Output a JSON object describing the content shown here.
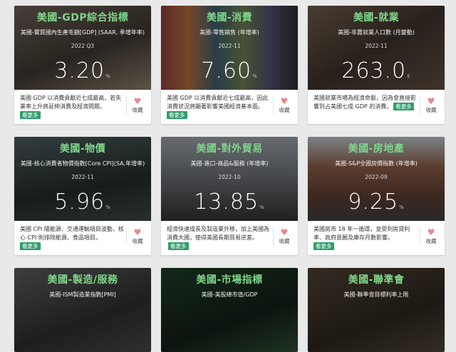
{
  "cards": [
    {
      "title": "美國-GDP綜合指標",
      "subtitle": "美國-實質國內生產毛額[GDP] (SAAR, 季增年率)",
      "date": "2022 Q3",
      "value": "3.20",
      "unit": "%",
      "desc": "美國 GDP 以消費貢獻近七成最高，若失業率上升將延伸消費及經濟問題。",
      "more": "看更多",
      "fav": "收藏",
      "bg": "#4a4036"
    },
    {
      "title": "美國-消費",
      "subtitle": "美國-零售銷售 (年增率)",
      "date": "2022-11",
      "value": "7.60",
      "unit": "%",
      "desc": "美國 GDP 以消費貢獻近七成最高，因此消費狀況將顯著影響美國經濟基本面。",
      "more": "看更多",
      "fav": "收藏",
      "bg": "#3a3a3a"
    },
    {
      "title": "美國-就業",
      "subtitle": "美國-非農就業人口數 (月變動)",
      "date": "2022-11",
      "value": "263.0",
      "unit": "K",
      "desc": "美國就業市場為經濟命脈，因為會直接影響到占美國七成 GDP 的消費。",
      "more": "看更多",
      "fav": "收藏",
      "bg": "#4d3d33"
    },
    {
      "title": "美國-物價",
      "subtitle": "美國-核心消費者物價指數[Core CPI](SA,年增率)",
      "date": "2022-11",
      "value": "5.96",
      "unit": "%",
      "desc": "美國 CPI 隨能源、交通運輸項目波動，核心 CPI 則排除能源、食品項目。",
      "more": "看更多",
      "fav": "收藏",
      "bg": "#2f3a3a"
    },
    {
      "title": "美國-對外貿易",
      "subtitle": "美國-進口-商品&服務 (年增率)",
      "date": "2022-10",
      "value": "13.85",
      "unit": "%",
      "desc": "經濟快速成長及製造業外移，加上美國為消費大國，使得美國長期貿易逆差。",
      "more": "看更多",
      "fav": "收藏",
      "bg": "#5a5a5a"
    },
    {
      "title": "美國-房地產",
      "subtitle": "美國-S&P全國房價指數 (年增率)",
      "date": "2022-09",
      "value": "9.25",
      "unit": "%",
      "desc": "美國房市 18 年一循環，並受到房貸利率、政府意願及庫存月數影響。",
      "more": "看更多",
      "fav": "收藏",
      "bg": "#6b4a3a"
    },
    {
      "title": "美國-製造/服務",
      "subtitle": "美國-ISM製造業指數[PMI]",
      "bg": "#3d3d3d"
    },
    {
      "title": "美國-市場指標",
      "subtitle": "美國-美股總市值/GDP",
      "bg": "#1f2a22"
    },
    {
      "title": "美國-聯準會",
      "subtitle": "美國-聯準會目標利率上限",
      "bg": "#3a2f24"
    }
  ]
}
